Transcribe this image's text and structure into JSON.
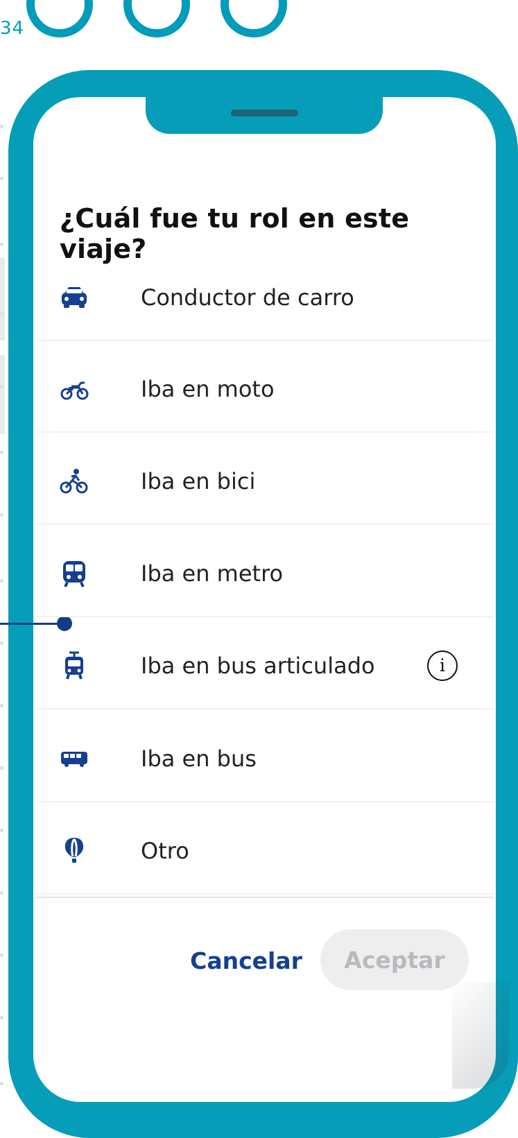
{
  "corner_number": "34",
  "dialog": {
    "title": "¿Cuál fue tu rol en este viaje?",
    "options": [
      {
        "label": "Conductor de carro",
        "icon": "car-icon"
      },
      {
        "label": "Iba en moto",
        "icon": "motorcycle-icon"
      },
      {
        "label": "Iba en bici",
        "icon": "bicycle-icon"
      },
      {
        "label": "Iba en metro",
        "icon": "metro-icon"
      },
      {
        "label": "Iba en bus articulado",
        "icon": "articulated-bus-icon",
        "info_icon": "info-icon"
      },
      {
        "label": "Iba en bus",
        "icon": "bus-icon"
      },
      {
        "label": "Otro",
        "icon": "balloon-icon"
      }
    ],
    "cancel_label": "Cancelar",
    "accept_label": "Aceptar"
  },
  "colors": {
    "phone_frame": "#069db8",
    "icon_blue": "#153f91",
    "title": "#111111",
    "accept_disabled_bg": "#eeeeee"
  }
}
